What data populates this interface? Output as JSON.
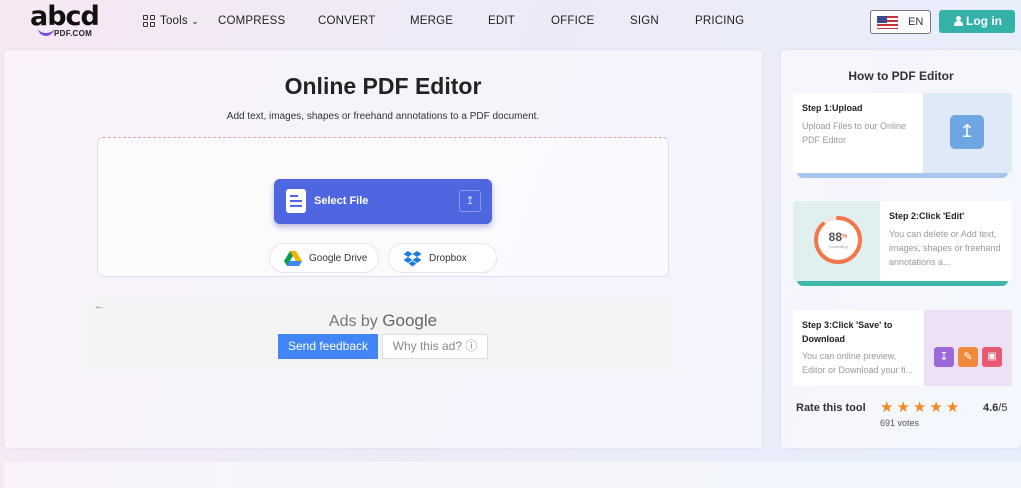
{
  "header": {
    "logo_main": "abcd",
    "logo_sub": "PDF.COM",
    "tools_label": "Tools",
    "nav": [
      "COMPRESS",
      "CONVERT",
      "MERGE",
      "EDIT",
      "OFFICE",
      "SIGN",
      "PRICING"
    ],
    "lang": "EN",
    "login": "Log in"
  },
  "main": {
    "title": "Online PDF Editor",
    "subtitle": "Add text, images, shapes or freehand annotations to a PDF document.",
    "select_file": "Select File",
    "google_drive": "Google Drive",
    "dropbox": "Dropbox"
  },
  "ad": {
    "back": "←",
    "prefix": "Ads by",
    "brand": "Google",
    "feedback": "Send feedback",
    "why": "Why this ad? ⓘ"
  },
  "sidebar": {
    "title": "How to PDF Editor",
    "steps": [
      {
        "head": "Step 1:Upload",
        "text": "Upload Files to our Online PDF Editor"
      },
      {
        "head": "Step 2:Click 'Edit'",
        "text": "You can delete or Add text, images, shapes or freehand annotations a...",
        "progress_label": "88",
        "progress_unit": "%",
        "progress_sub": "Converting",
        "progress": 0.88
      },
      {
        "head": "Step 3:Click 'Save' to Download",
        "text": "You can online preview, Editor or Download your fi..."
      }
    ],
    "rate_label": "Rate this tool",
    "rating": "4.6",
    "rating_max": "/5",
    "votes": "691 votes",
    "stars": 5
  },
  "colors": {
    "accent": "#4e66e0",
    "teal": "#35b2a8",
    "star": "#f28a22"
  }
}
